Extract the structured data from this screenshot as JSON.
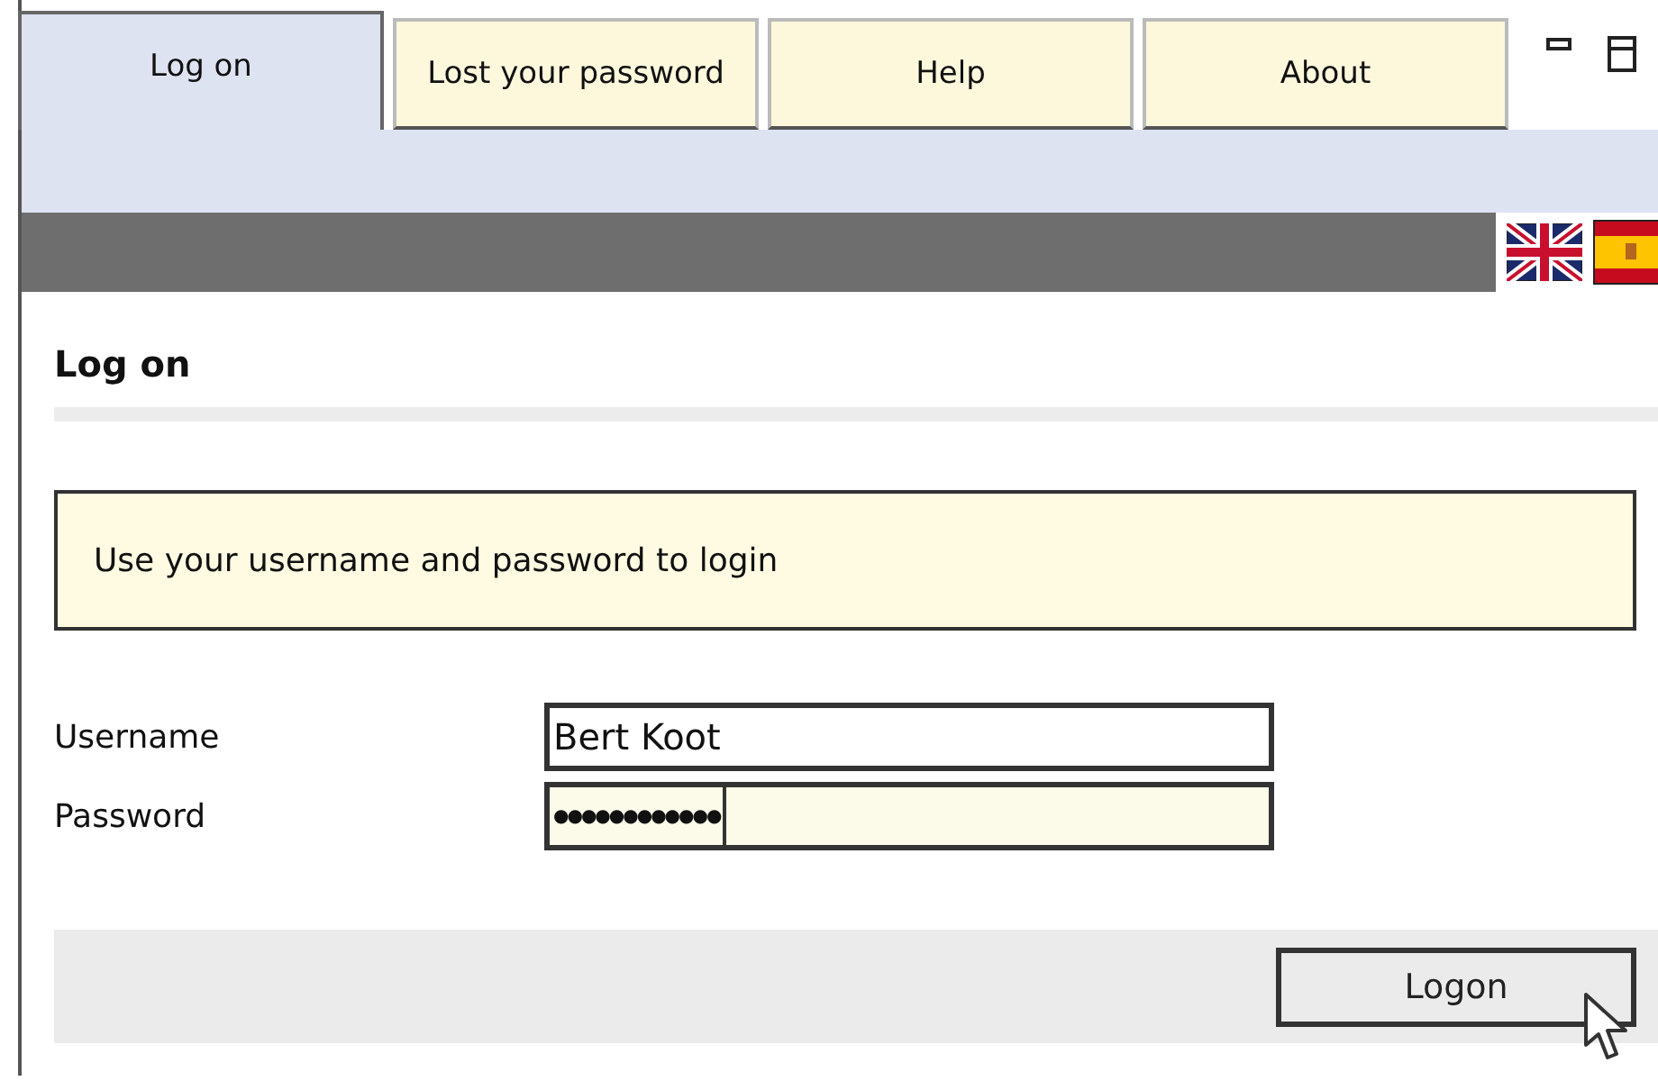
{
  "tabs": [
    {
      "label": "Log on",
      "selected": true
    },
    {
      "label": "Lost your password",
      "selected": false
    },
    {
      "label": "Help",
      "selected": false
    },
    {
      "label": "About",
      "selected": false
    }
  ],
  "heading": "Log on",
  "info": "Use your username and password to login",
  "fields": [
    {
      "label": "Username",
      "value": "Bert Koot",
      "kind": "text"
    },
    {
      "label": "Password",
      "value": "●●●●●●●●●●●●",
      "kind": "password"
    }
  ],
  "button": "Logon"
}
